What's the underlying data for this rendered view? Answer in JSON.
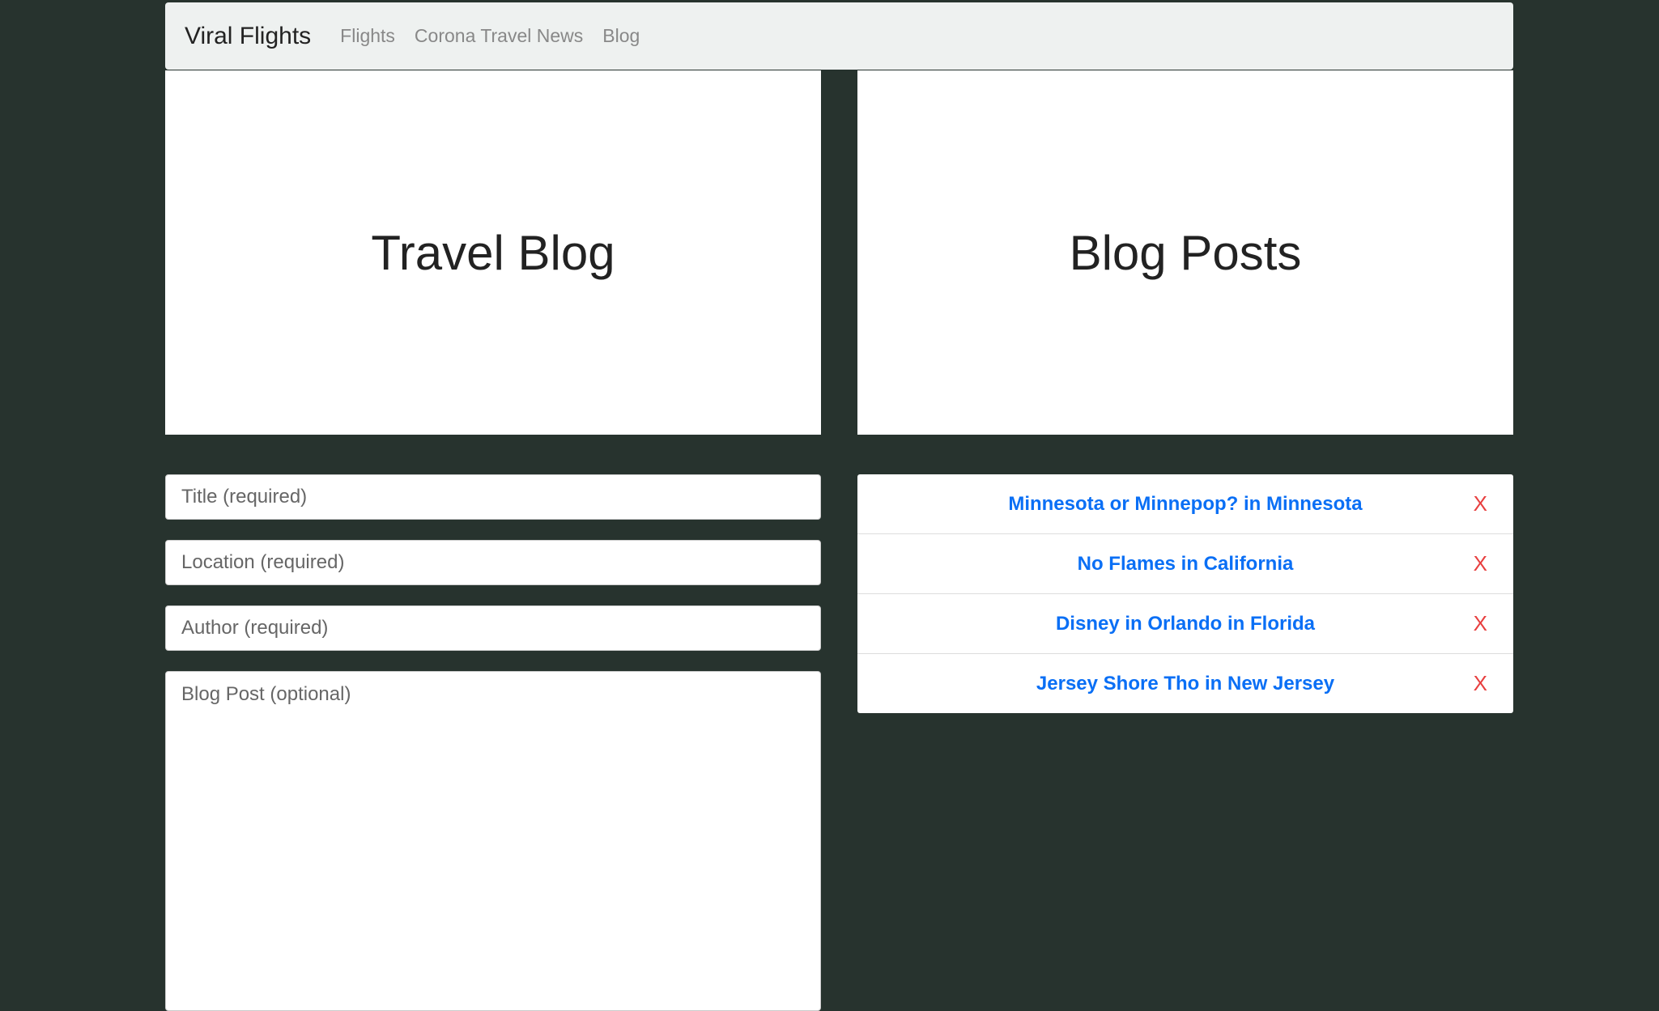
{
  "nav": {
    "brand": "Viral Flights",
    "links": [
      "Flights",
      "Corona Travel News",
      "Blog"
    ]
  },
  "left": {
    "title": "Travel Blog",
    "fields": {
      "title": "Title (required)",
      "location": "Location (required)",
      "author": "Author (required)",
      "post": "Blog Post (optional)"
    }
  },
  "right": {
    "title": "Blog Posts",
    "posts": [
      "Minnesota or Minnepop? in Minnesota",
      "No Flames in California",
      "Disney in Orlando in Florida",
      "Jersey Shore Tho in New Jersey"
    ],
    "delete_label": "X"
  }
}
